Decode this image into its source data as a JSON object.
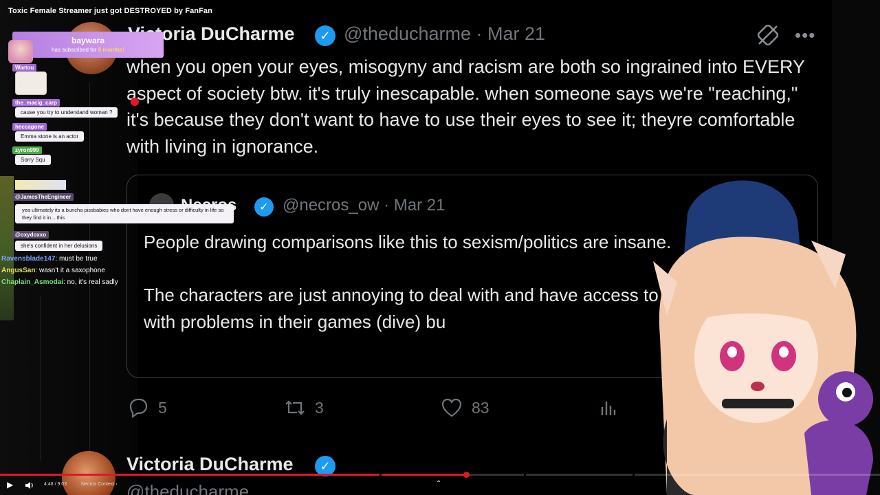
{
  "video": {
    "title": "Toxic Female Streamer just got DESTROYED by FanFan"
  },
  "tweet": {
    "author": "Victoria DuCharme",
    "meta": "@theducharme · Mar 21",
    "text": "when you open your eyes, misogyny and racism are both so ingrained into EVERY aspect of society btw. it's truly inescapable. when someone says we're \"reaching,\" it's because they don't want to have to use their eyes to see it; theyre comfortable with living in ignorance.",
    "verified_color": "#1d9bf0",
    "quote": {
      "author": "Necros",
      "meta": "@necros_ow · Mar 21",
      "text": "People drawing comparisons like this to sexism/politics are insane.\n\nThe characters are just annoying to deal with and have access to easy tools to deal with problems in their games (dive) bu"
    },
    "actions": {
      "replies": "5",
      "retweets": "3",
      "likes": "83"
    }
  },
  "tweet2": {
    "author": "Victoria DuCharme",
    "handle": "@theducharme"
  },
  "chat": {
    "sub_alert": {
      "user": "baywara",
      "text_prefix": "has subscribed for",
      "duration": "8 months!"
    },
    "messages": [
      {
        "user": "Wartou",
        "text": ""
      },
      {
        "user": "the_macig_carp",
        "text": "cause you try to understand woman ?"
      },
      {
        "user": "heccagone",
        "text": "Emma stone is an actor"
      },
      {
        "user": "zyron999",
        "text": "Sorry Squ"
      },
      {
        "user": "@JamesTheEngineer",
        "text": "yea ultimately its a buncha pissbabies who dont have enough stress or difficulty in life so they find it in... this"
      },
      {
        "user": "@oxydoxxo",
        "text": "she's confident in her delusions"
      }
    ],
    "plain_messages": [
      {
        "user": "Ravensblade147",
        "text": ": must be true"
      },
      {
        "user": "AngusSan",
        "text": ": wasn't it a saxophone"
      },
      {
        "user": "Chaplain_Asmodai",
        "text": ": no, it's real sadly"
      }
    ]
  },
  "player": {
    "time": "4:48 / 9:03",
    "chapter": "Necros Context",
    "progress_fraction": 0.53,
    "accent": "#e0182a"
  }
}
